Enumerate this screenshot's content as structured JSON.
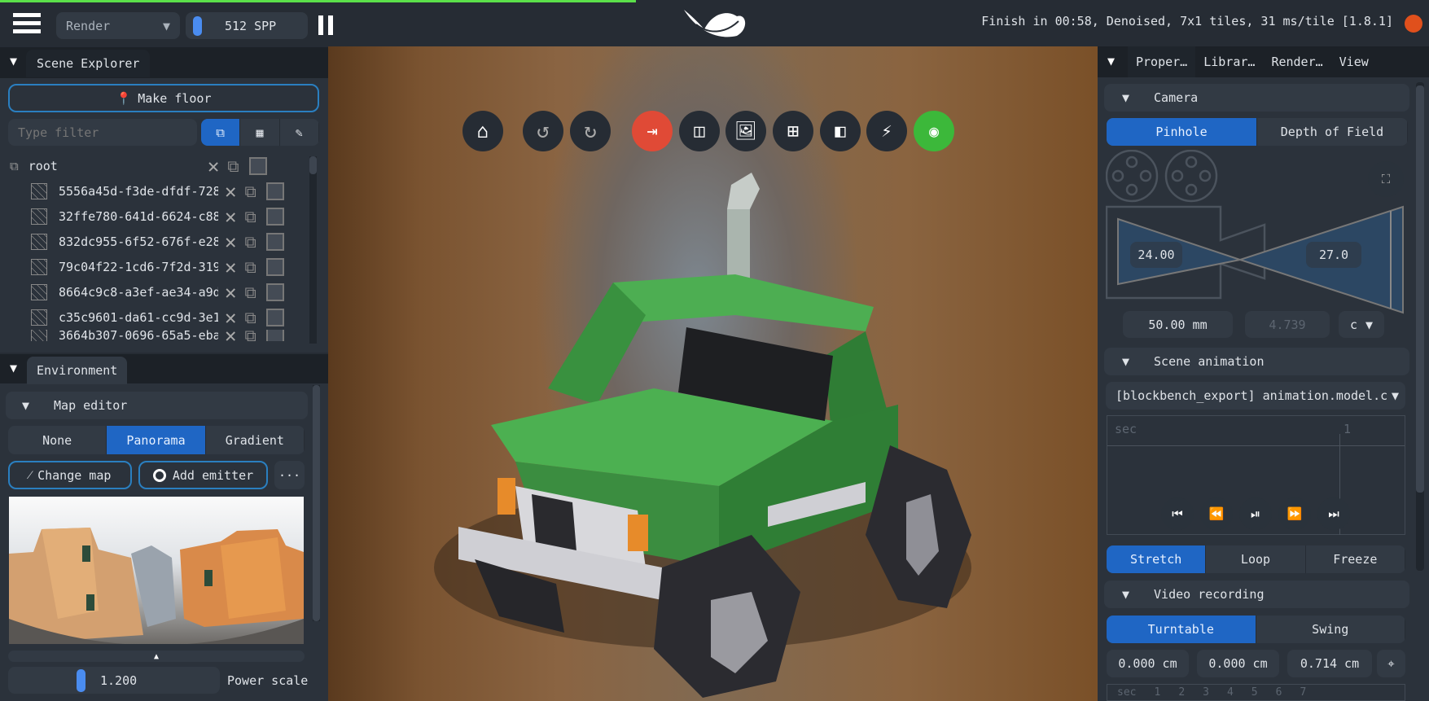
{
  "topbar": {
    "mode": "Render",
    "spp": "512 SPP",
    "status": "Finish in 00:58, Denoised, 7x1 tiles, 31 ms/tile [1.8.1]",
    "progress_fraction": 0.445,
    "status_dot_color": "#e0501c"
  },
  "scene_explorer": {
    "title": "Scene Explorer",
    "make_floor": "Make floor",
    "filter_placeholder": "Type filter",
    "root": "root",
    "items": [
      "5556a45d-f3de-dfdf-728",
      "32ffe780-641d-6624-c88",
      "832dc955-6f52-676f-e28",
      "79c04f22-1cd6-7f2d-319",
      "8664c9c8-a3ef-ae34-a9d",
      "c35c9601-da61-cc9d-3e1",
      "3664b307-0696-65a5-eba"
    ]
  },
  "environment": {
    "tab": "Environment",
    "map_editor": "Map editor",
    "modes": [
      "None",
      "Panorama",
      "Gradient"
    ],
    "selected_mode": "Panorama",
    "change_map": "Change map",
    "add_emitter": "Add emitter",
    "more": "···",
    "power_value": "1.200",
    "power_label": "Power scale"
  },
  "right": {
    "tabs": [
      "Proper…",
      "Librar…",
      "Render…",
      "View"
    ],
    "camera": {
      "title": "Camera",
      "modes": [
        "Pinhole",
        "Depth of Field"
      ],
      "sensor": "24.00",
      "fov": "27.0",
      "focal": "50.00 mm",
      "aperture": "4.739",
      "aperture_unit": "c"
    },
    "scene_animation": {
      "title": "Scene animation",
      "clip": "[blockbench_export] animation.model.c",
      "axis_label": "sec",
      "tick_label": "1",
      "modes": [
        "Stretch",
        "Loop",
        "Freeze"
      ]
    },
    "video": {
      "title": "Video recording",
      "modes": [
        "Turntable",
        "Swing"
      ],
      "x": "0.000 cm",
      "y": "0.000 cm",
      "z": "0.714 cm",
      "ticks": [
        "sec",
        "1",
        "2",
        "3",
        "4",
        "5",
        "6",
        "7"
      ]
    }
  },
  "colors": {
    "accent": "#1f66c4",
    "record": "#e04a36",
    "discord": "#3cb83a"
  }
}
